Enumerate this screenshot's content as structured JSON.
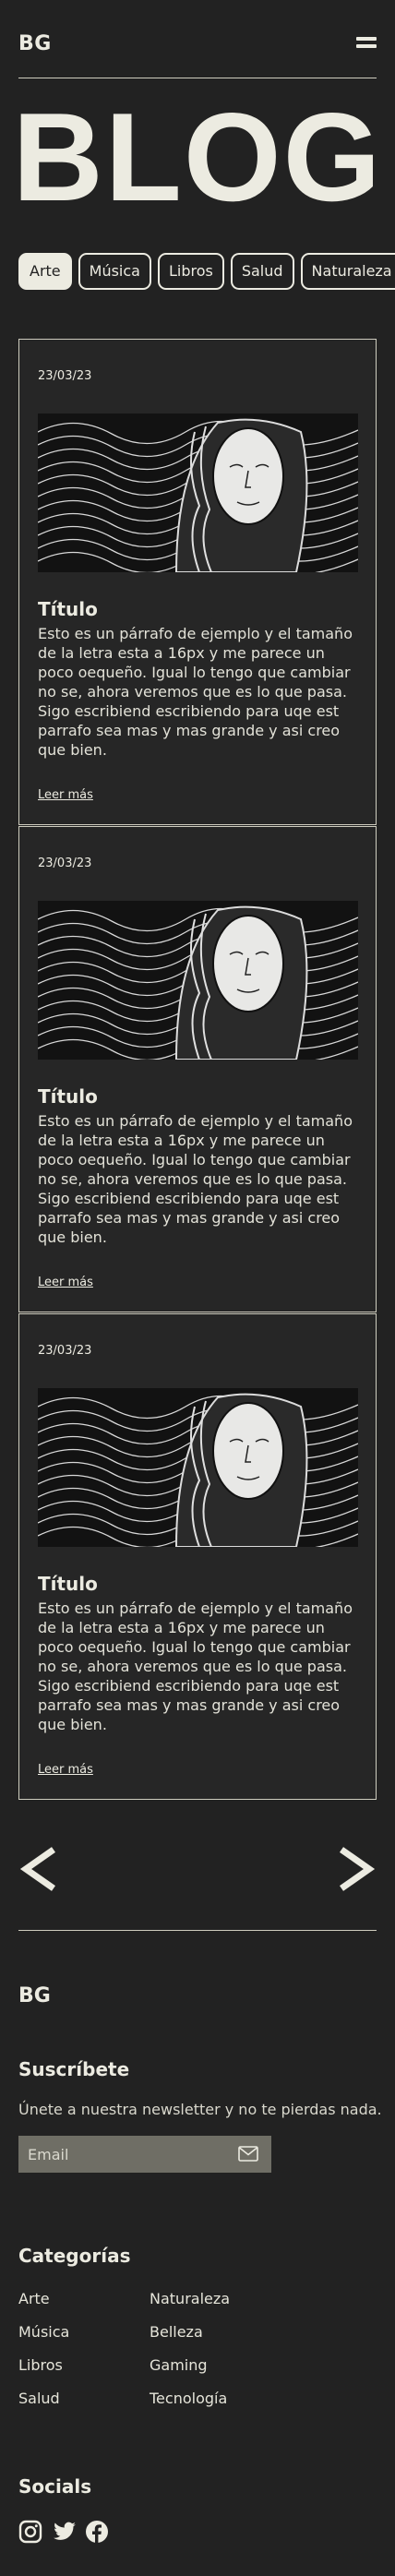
{
  "header": {
    "logo": "BG",
    "menu_icon": "hamburger-menu-icon"
  },
  "hero": {
    "title": "BLOG"
  },
  "filters": [
    "Arte",
    "Música",
    "Libros",
    "Salud",
    "Naturaleza"
  ],
  "posts": [
    {
      "date": "23/03/23",
      "title": "Título",
      "text": "Esto es un párrafo de ejemplo y el tamaño de la letra esta a 16px y me parece un poco oequeño. Igual lo tengo que cambiar no se, ahora veremos que es lo que pasa. Sigo escribiend escribiendo para uqe est parrafo sea mas y mas grande y asi creo que bien.",
      "link": "Leer más"
    },
    {
      "date": "23/03/23",
      "title": "Título",
      "text": "Esto es un párrafo de ejemplo y el tamaño de la letra esta a 16px y me parece un poco oequeño. Igual lo tengo que cambiar no se, ahora veremos que es lo que pasa. Sigo escribiend escribiendo para uqe est parrafo sea mas y mas grande y asi creo que bien.",
      "link": "Leer más"
    },
    {
      "date": "23/03/23",
      "title": "Título",
      "text": "Esto es un párrafo de ejemplo y el tamaño de la letra esta a 16px y me parece un poco oequeño. Igual lo tengo que cambiar no se, ahora veremos que es lo que pasa. Sigo escribiend escribiendo para uqe est parrafo sea mas y mas grande y asi creo que bien.",
      "link": "Leer más"
    }
  ],
  "pagination": {
    "prev_icon": "chevron-left-icon",
    "next_icon": "chevron-right-icon"
  },
  "footer": {
    "logo": "BG",
    "subscribe": {
      "heading": "Suscríbete",
      "text": "Únete a nuestra newsletter y no te pierdas nada.",
      "placeholder": "Email",
      "icon": "mail-icon"
    },
    "categories": {
      "heading": "Categorías",
      "col1": [
        "Arte",
        "Música",
        "Libros",
        "Salud"
      ],
      "col2": [
        "Naturaleza",
        "Belleza",
        "Gaming",
        "Tecnología"
      ]
    },
    "socials": {
      "heading": "Socials",
      "icons": [
        "instagram-icon",
        "twitter-icon",
        "facebook-icon"
      ]
    }
  },
  "colors": {
    "background": "#222222",
    "foreground": "#ecebe1",
    "input": "#6f6e65"
  }
}
